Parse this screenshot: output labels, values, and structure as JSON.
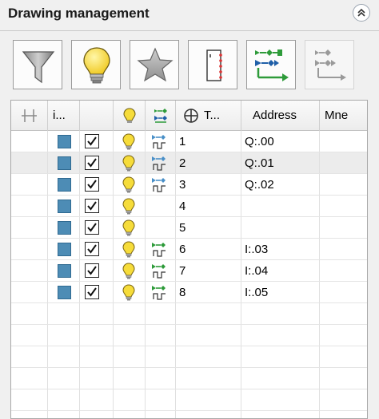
{
  "panel": {
    "title": "Drawing management"
  },
  "toolbar": {
    "buttons": [
      {
        "name": "filter",
        "icon": "funnel-icon"
      },
      {
        "name": "visibility",
        "icon": "lightbulb-icon"
      },
      {
        "name": "favorites",
        "icon": "star-icon"
      },
      {
        "name": "drawing-frame",
        "icon": "terminal-strip-icon"
      },
      {
        "name": "signal-flow",
        "icon": "signal-flow-icon"
      },
      {
        "name": "signal-flow-alt",
        "icon": "signal-flow-disabled-icon"
      }
    ]
  },
  "grid": {
    "headers": {
      "col1": "",
      "col2": "i...",
      "col3": "",
      "col4": "",
      "col5": "",
      "tag": "T...",
      "address": "Address",
      "mnemonic": "Mne"
    },
    "rows": [
      {
        "number": "1",
        "address": "Q:.00",
        "type": "output",
        "selected": false
      },
      {
        "number": "2",
        "address": "Q:.01",
        "type": "output",
        "selected": true
      },
      {
        "number": "3",
        "address": "Q:.02",
        "type": "output",
        "selected": false
      },
      {
        "number": "4",
        "address": "",
        "type": "none",
        "selected": false
      },
      {
        "number": "5",
        "address": "",
        "type": "none",
        "selected": false
      },
      {
        "number": "6",
        "address": "I:.03",
        "type": "input",
        "selected": false
      },
      {
        "number": "7",
        "address": "I:.04",
        "type": "input",
        "selected": false
      },
      {
        "number": "8",
        "address": "I:.05",
        "type": "input",
        "selected": false
      }
    ]
  },
  "colors": {
    "layer": "#4d8cb5",
    "bulb": "#f6dc3a",
    "output_signal": "#4a90c8",
    "input_signal": "#2e9b3a"
  }
}
